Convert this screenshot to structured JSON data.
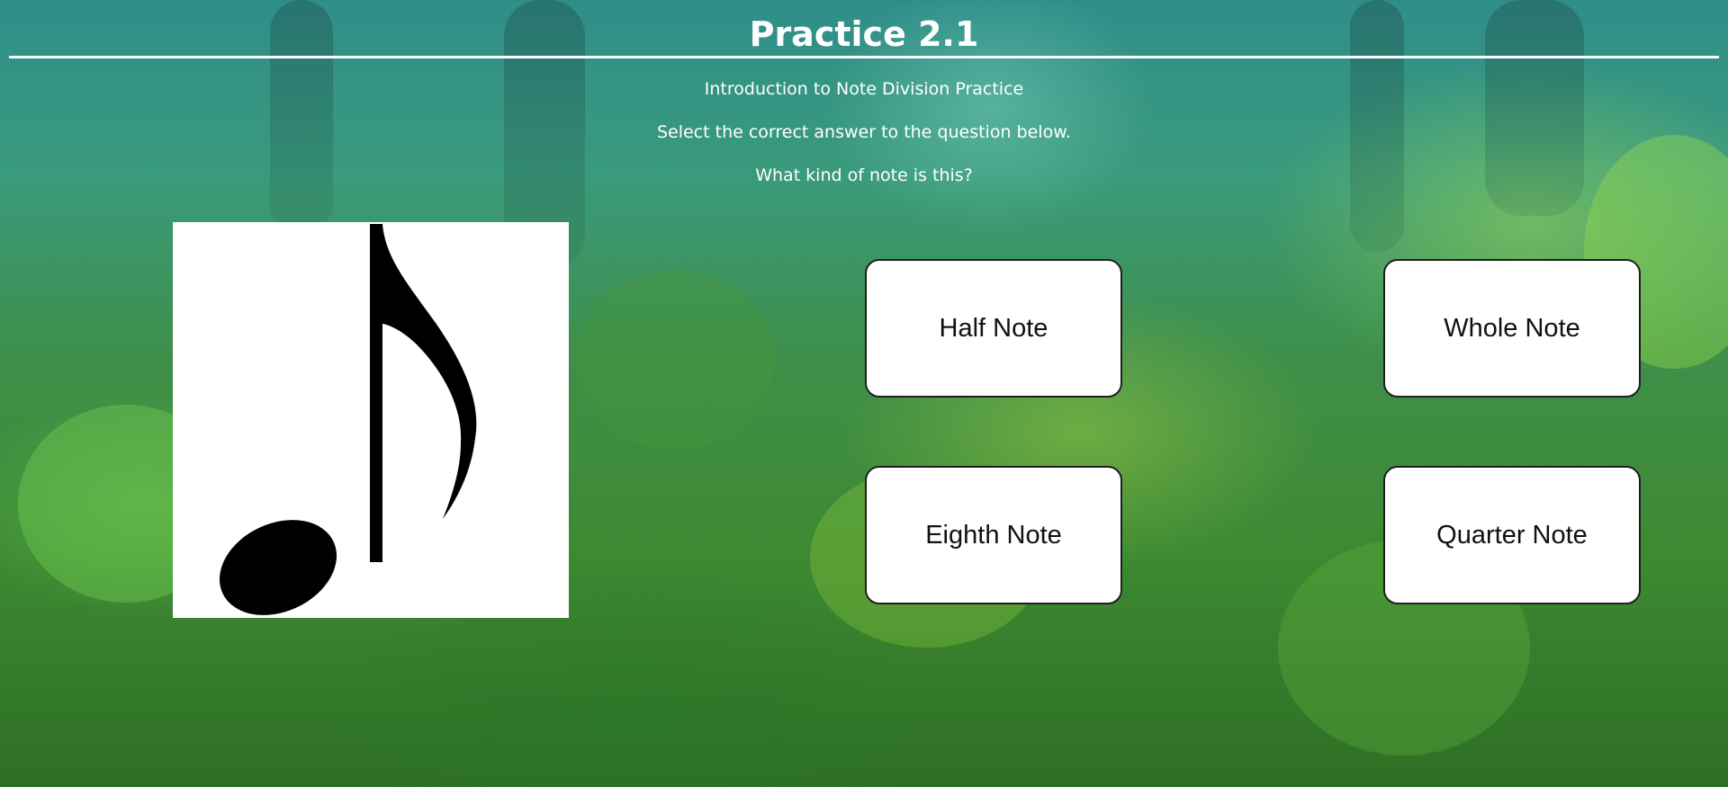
{
  "header": {
    "title": "Practice 2.1"
  },
  "intro": {
    "subtitle": "Introduction to Note Division Practice",
    "instruction": "Select the correct answer to the question below.",
    "question": "What kind of note is this?"
  },
  "question_image": {
    "icon": "eighth-note-icon"
  },
  "answers": [
    {
      "label": "Half Note"
    },
    {
      "label": "Whole Note"
    },
    {
      "label": "Eighth Note"
    },
    {
      "label": "Quarter Note"
    }
  ],
  "colors": {
    "text": "#ffffff",
    "button_bg": "#ffffff",
    "button_border": "#1f1f1f"
  }
}
